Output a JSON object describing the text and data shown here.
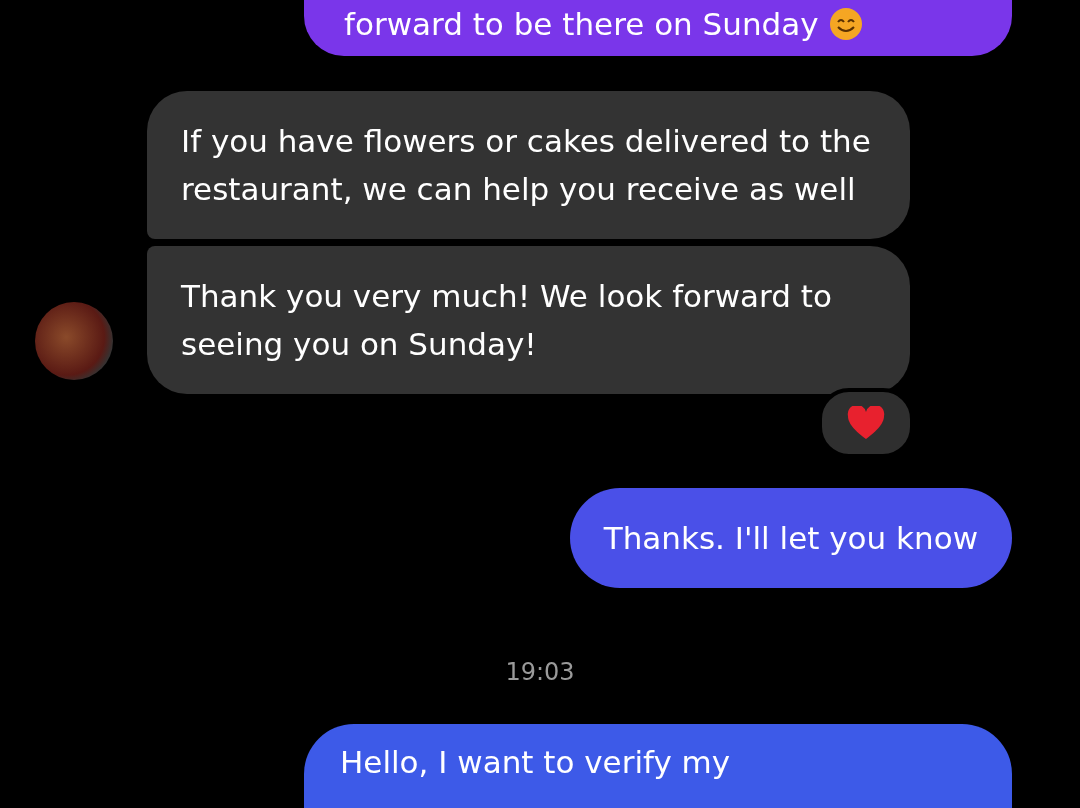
{
  "messages": [
    {
      "kind": "sent",
      "text": "forward to be there on Sunday",
      "smiley": true
    },
    {
      "kind": "received",
      "bubbles": [
        {
          "text": "If you have flowers or cakes delivered to the restaurant, we can help you receive as well",
          "reacted": false
        },
        {
          "text": "Thank you very much! We look forward to seeing you on Sunday!",
          "reacted": true
        }
      ]
    },
    {
      "kind": "sent",
      "text": "Thanks. I'll let you know",
      "smiley": false
    },
    {
      "kind": "timestamp",
      "text": "19:03"
    },
    {
      "kind": "sent",
      "text": "Hello, I want to verify my",
      "smiley": false
    }
  ]
}
